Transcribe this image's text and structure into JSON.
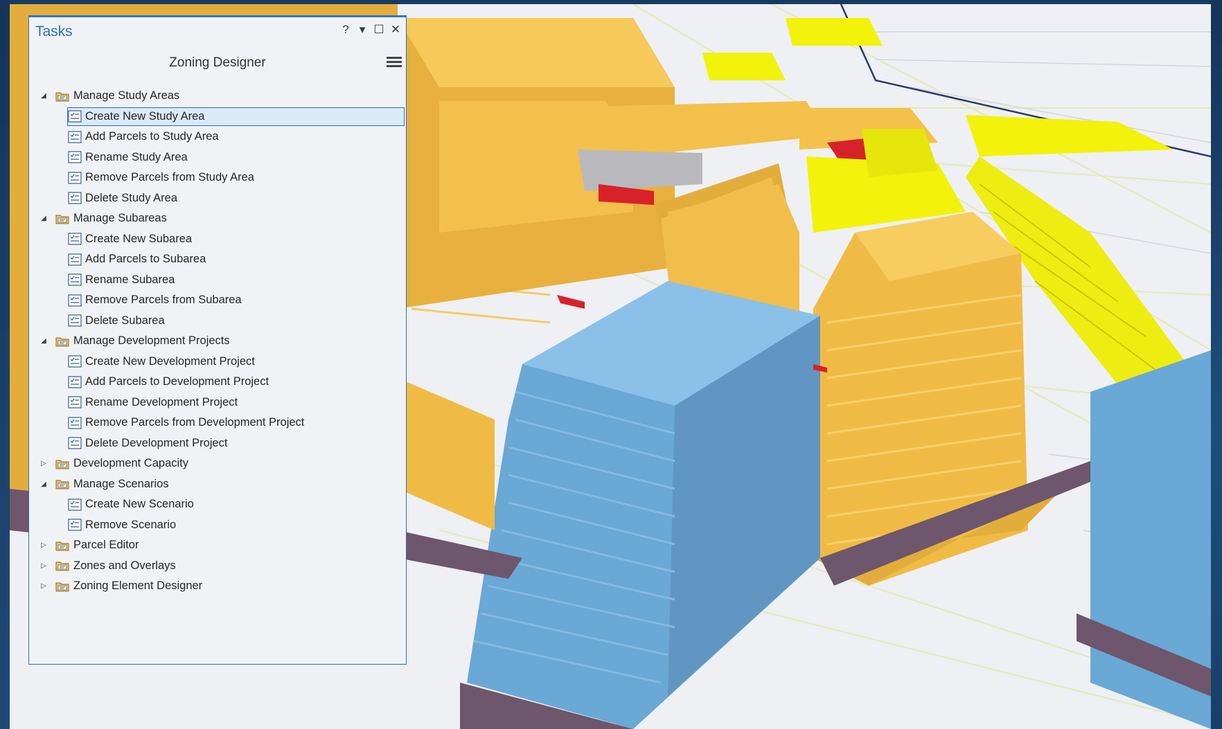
{
  "pane": {
    "title": "Tasks",
    "controls": [
      "?",
      "▾",
      "☐",
      "✕"
    ],
    "subtitle": "Zoning Designer"
  },
  "tree": [
    {
      "type": "group",
      "label": "Manage Study Areas",
      "expanded": true
    },
    {
      "type": "task",
      "label": "Create New Study Area",
      "selected": true
    },
    {
      "type": "task",
      "label": "Add Parcels to Study Area"
    },
    {
      "type": "task",
      "label": "Rename Study Area"
    },
    {
      "type": "task",
      "label": "Remove Parcels from Study Area"
    },
    {
      "type": "task",
      "label": "Delete Study Area"
    },
    {
      "type": "group",
      "label": "Manage Subareas",
      "expanded": true
    },
    {
      "type": "task",
      "label": "Create New Subarea"
    },
    {
      "type": "task",
      "label": "Add Parcels to Subarea"
    },
    {
      "type": "task",
      "label": "Rename Subarea"
    },
    {
      "type": "task",
      "label": "Remove Parcels from Subarea"
    },
    {
      "type": "task",
      "label": "Delete Subarea"
    },
    {
      "type": "group",
      "label": "Manage Development Projects",
      "expanded": true
    },
    {
      "type": "task",
      "label": "Create New Development Project"
    },
    {
      "type": "task",
      "label": "Add Parcels to Development Project"
    },
    {
      "type": "task",
      "label": "Rename Development Project"
    },
    {
      "type": "task",
      "label": "Remove Parcels from Development Project"
    },
    {
      "type": "task",
      "label": "Delete Development Project"
    },
    {
      "type": "group",
      "label": "Development Capacity",
      "expanded": false
    },
    {
      "type": "group",
      "label": "Manage Scenarios",
      "expanded": true
    },
    {
      "type": "task",
      "label": "Create New Scenario"
    },
    {
      "type": "task",
      "label": "Remove Scenario"
    },
    {
      "type": "group",
      "label": "Parcel Editor",
      "expanded": false
    },
    {
      "type": "group",
      "label": "Zones and Overlays",
      "expanded": false
    },
    {
      "type": "group",
      "label": "Zoning Element Designer",
      "expanded": false
    }
  ],
  "colors": {
    "accent": "#2b6cb6",
    "building_orange": "#f4c24a",
    "building_yellow": "#f2f20a",
    "building_blue": "#6aa8d6",
    "base_purple": "#6e566c",
    "highlight_red": "#d8222a"
  }
}
